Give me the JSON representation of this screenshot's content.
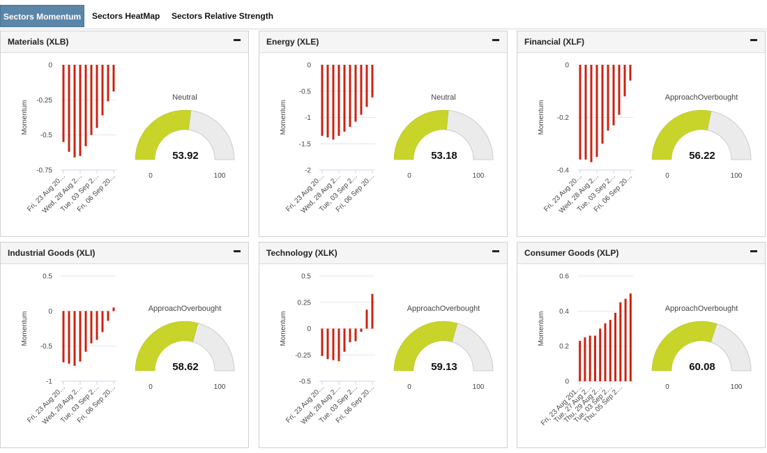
{
  "tabs": [
    {
      "label": "Sectors Momentum",
      "active": true
    },
    {
      "label": "Sectors HeatMap",
      "active": false
    },
    {
      "label": "Sectors Relative Strength",
      "active": false
    }
  ],
  "colors": {
    "bar": "#cc2211",
    "gauge_fill": "#c8d42a",
    "gauge_rest": "#ebebeb",
    "tab_active": "#5b86a8"
  },
  "panels": [
    {
      "title": "Materials (XLB)",
      "chart_data": {
        "type": "bar",
        "ylabel": "Momentum",
        "ylim": [
          -0.75,
          0
        ],
        "yticks": [
          "0",
          "-0.25",
          "-0.5",
          "-0.75"
        ],
        "ytick_values": [
          0,
          -0.25,
          -0.5,
          -0.75
        ],
        "values": [
          -0.55,
          -0.62,
          -0.66,
          -0.65,
          -0.58,
          -0.5,
          -0.45,
          -0.36,
          -0.26,
          -0.19
        ],
        "xtick_labels": [
          "Fri, 23 Aug 20…",
          "Wed, 28 Aug 2…",
          "Tue, 03 Sep 2…",
          "Fri, 06 Sep 20…"
        ]
      },
      "gauge": {
        "status": "Neutral",
        "value": 53.92,
        "value_label": "53.92",
        "min_label": "0",
        "max_label": "100",
        "min": 0,
        "max": 100
      }
    },
    {
      "title": "Energy (XLE)",
      "chart_data": {
        "type": "bar",
        "ylabel": "Momentum",
        "ylim": [
          -2,
          0
        ],
        "yticks": [
          "0",
          "-0.5",
          "-1",
          "-1.5",
          "-2"
        ],
        "ytick_values": [
          0,
          -0.5,
          -1,
          -1.5,
          -2
        ],
        "values": [
          -1.35,
          -1.38,
          -1.42,
          -1.35,
          -1.27,
          -1.18,
          -1.08,
          -0.95,
          -0.8,
          -0.62
        ],
        "xtick_labels": [
          "Fri, 23 Aug 20…",
          "Wed, 28 Aug 2…",
          "Tue, 03 Sep 2…",
          "Fri, 06 Sep 20…"
        ]
      },
      "gauge": {
        "status": "Neutral",
        "value": 53.18,
        "value_label": "53.18",
        "min_label": "0",
        "max_label": "100",
        "min": 0,
        "max": 100
      }
    },
    {
      "title": "Financial (XLF)",
      "chart_data": {
        "type": "bar",
        "ylabel": "Momentum",
        "ylim": [
          -0.4,
          0
        ],
        "yticks": [
          "0",
          "-0.2",
          "-0.4"
        ],
        "ytick_values": [
          0,
          -0.2,
          -0.4
        ],
        "values": [
          -0.36,
          -0.36,
          -0.37,
          -0.35,
          -0.3,
          -0.25,
          -0.23,
          -0.19,
          -0.12,
          -0.06
        ],
        "xtick_labels": [
          "Fri, 23 Aug 20…",
          "Wed, 28 Aug 2…",
          "Tue, 03 Sep 2…",
          "Fri, 06 Sep 20…"
        ]
      },
      "gauge": {
        "status": "ApproachOverbought",
        "value": 56.22,
        "value_label": "56.22",
        "min_label": "0",
        "max_label": "100",
        "min": 0,
        "max": 100
      }
    },
    {
      "title": "Industrial Goods (XLI)",
      "chart_data": {
        "type": "bar",
        "ylabel": "Momentum",
        "ylim": [
          -1,
          0.5
        ],
        "yticks": [
          "0.5",
          "0",
          "-0.5",
          "-1"
        ],
        "ytick_values": [
          0.5,
          0,
          -0.5,
          -1
        ],
        "values": [
          -0.73,
          -0.75,
          -0.78,
          -0.72,
          -0.58,
          -0.46,
          -0.41,
          -0.3,
          -0.14,
          0.05
        ],
        "xtick_labels": [
          "Fri, 23 Aug 20…",
          "Wed, 28 Aug 2…",
          "Tue, 03 Sep 2…",
          "Fri, 06 Sep 20…"
        ]
      },
      "gauge": {
        "status": "ApproachOverbought",
        "value": 58.62,
        "value_label": "58.62",
        "min_label": "0",
        "max_label": "100",
        "min": 0,
        "max": 100
      }
    },
    {
      "title": "Technology (XLK)",
      "chart_data": {
        "type": "bar",
        "ylabel": "Momentum",
        "ylim": [
          -0.5,
          0.5
        ],
        "yticks": [
          "0.5",
          "0.25",
          "0",
          "-0.25",
          "-0.5"
        ],
        "ytick_values": [
          0.5,
          0.25,
          0,
          -0.25,
          -0.5
        ],
        "values": [
          -0.26,
          -0.29,
          -0.3,
          -0.31,
          -0.22,
          -0.13,
          -0.12,
          -0.03,
          0.18,
          0.33
        ],
        "xtick_labels": [
          "Fri, 23 Aug 20…",
          "Wed, 28 Aug 2…",
          "Tue, 03 Sep 2…",
          "Fri, 06 Sep 20…"
        ]
      },
      "gauge": {
        "status": "ApproachOverbought",
        "value": 59.13,
        "value_label": "59.13",
        "min_label": "0",
        "max_label": "100",
        "min": 0,
        "max": 100
      }
    },
    {
      "title": "Consumer Goods (XLP)",
      "chart_data": {
        "type": "bar",
        "ylabel": "Momentum",
        "ylim": [
          0,
          0.6
        ],
        "yticks": [
          "0.6",
          "0.4",
          "0.2",
          "0"
        ],
        "ytick_values": [
          0.6,
          0.4,
          0.2,
          0
        ],
        "values": [
          0.23,
          0.25,
          0.26,
          0.26,
          0.3,
          0.33,
          0.35,
          0.39,
          0.45,
          0.47,
          0.5
        ],
        "xtick_labels": [
          "Fri, 23 Aug 201…",
          "Tue, 27 Aug 2…",
          "Thu, 29 Aug 2…",
          "Tue, 03 Sep 2…",
          "Thu, 05 Sep 2…"
        ]
      },
      "gauge": {
        "status": "ApproachOverbought",
        "value": 60.08,
        "value_label": "60.08",
        "min_label": "0",
        "max_label": "100",
        "min": 0,
        "max": 100
      }
    }
  ]
}
